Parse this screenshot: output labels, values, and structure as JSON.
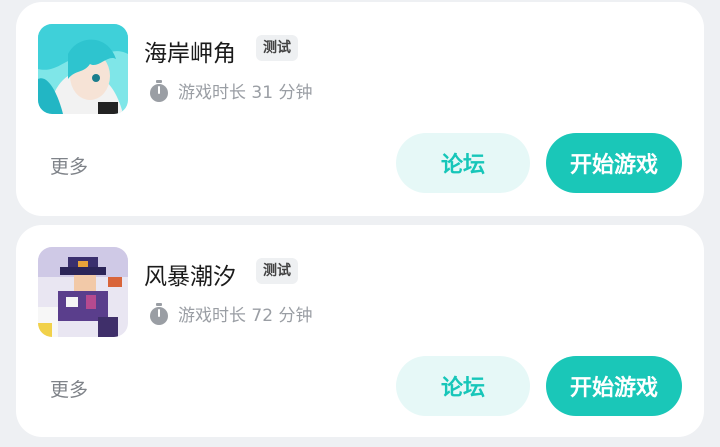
{
  "games": [
    {
      "title": "海岸岬角",
      "badge": "测试",
      "playtime": "游戏时长 31 分钟",
      "more_label": "更多",
      "forum_label": "论坛",
      "play_label": "开始游戏"
    },
    {
      "title": "风暴潮汐",
      "badge": "测试",
      "playtime": "游戏时长 72 分钟",
      "more_label": "更多",
      "forum_label": "论坛",
      "play_label": "开始游戏"
    }
  ],
  "colors": {
    "accent": "#1ac7b8",
    "accent_light": "#e6f8f7",
    "text_muted": "#9a9ea4"
  }
}
